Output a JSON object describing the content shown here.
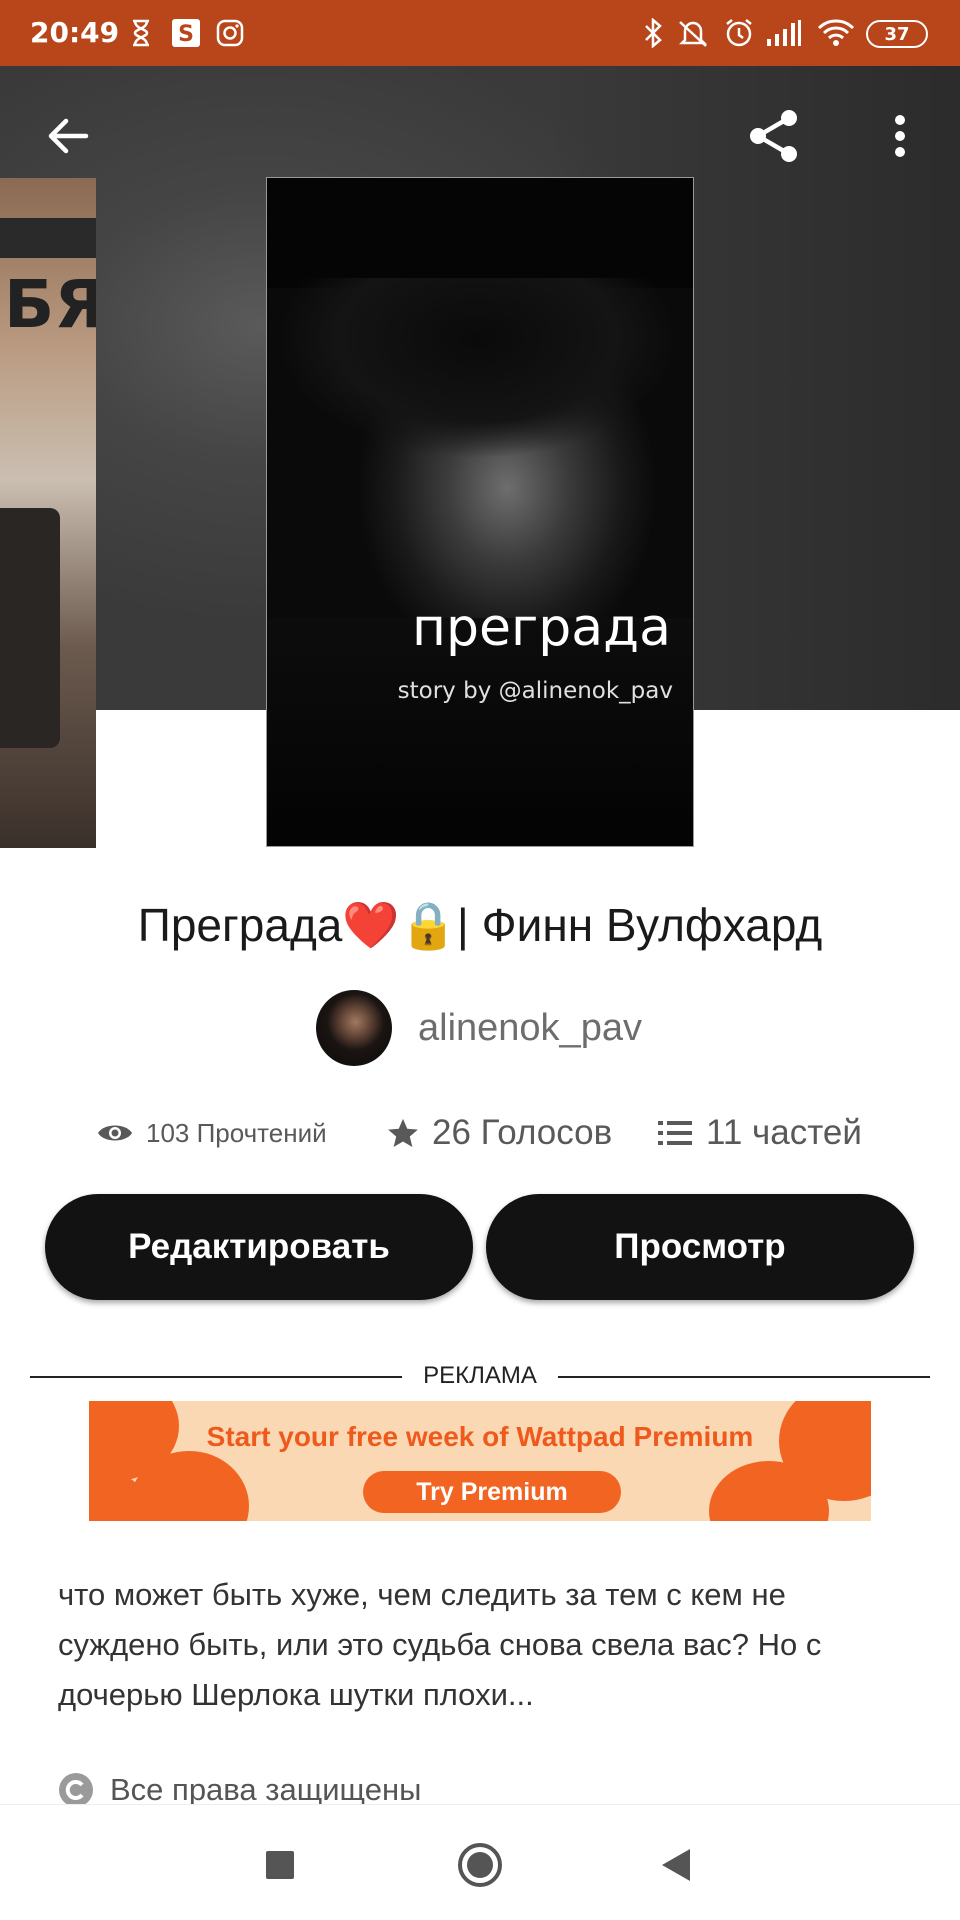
{
  "status_bar": {
    "time": "20:49",
    "battery": "37",
    "icons": [
      "hourglass-icon",
      "s-app-icon",
      "instagram-icon",
      "bluetooth-icon",
      "mute-icon",
      "alarm-icon",
      "signal-icon",
      "wifi-icon",
      "battery-icon"
    ]
  },
  "toolbar": {
    "icons": [
      "back-arrow-icon",
      "share-icon",
      "more-vert-icon"
    ]
  },
  "cover": {
    "title": "преграда",
    "subtitle": "story by @alinenok_pav"
  },
  "side_cover": {
    "glyph": "БЯ"
  },
  "story": {
    "title": "Преграда❤️🔒| Финн Вулфхард",
    "author": "alinenok_pav"
  },
  "stats": {
    "reads": "103 Прочтений",
    "votes": "26 Голосов",
    "parts": "11 частей"
  },
  "actions": {
    "edit_label": "Редактировать",
    "view_label": "Просмотр"
  },
  "ad": {
    "label": "РЕКЛАМА",
    "headline": "Start your free week of Wattpad Premium",
    "cta": "Try Premium"
  },
  "description": "что может быть хуже, чем следить за тем с кем не суждено быть, или это судьба снова свела вас? Но с дочерью Шерлока шутки плохи...",
  "copyright": "Все права защищены",
  "colors": {
    "status_bar": "#b8461a",
    "button_bg": "#121212",
    "ad_orange": "#f26422",
    "ad_peach": "#fbd8b4"
  }
}
